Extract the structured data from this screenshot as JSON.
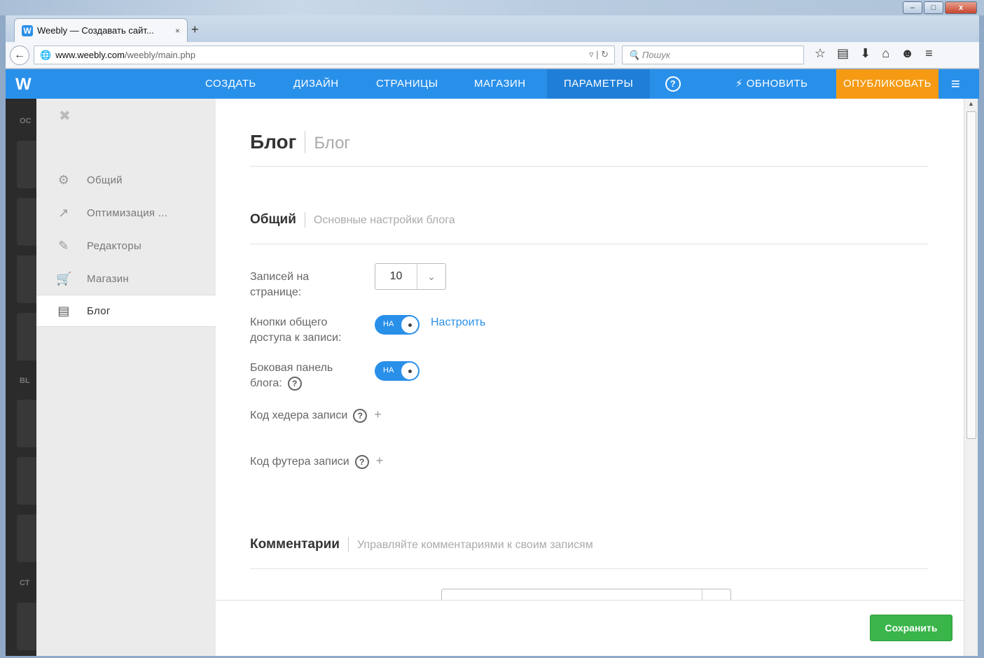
{
  "browser": {
    "tab_title": "Weebly — Создавать сайт...",
    "tab_close": "×",
    "new_tab": "+",
    "url_host": "www.weebly.com",
    "url_path": "/weebly/main.php",
    "search_placeholder": "Пошук",
    "window_controls": [
      "–",
      "□",
      "x"
    ]
  },
  "header": {
    "logo": "W",
    "menu": [
      {
        "label": "СОЗДАТЬ"
      },
      {
        "label": "ДИЗАЙН"
      },
      {
        "label": "СТРАНИЦЫ"
      },
      {
        "label": "МАГАЗИН"
      },
      {
        "label": "ПАРАМЕТРЫ",
        "active": true
      }
    ],
    "help": "?",
    "update_label": "ОБНОВИТЬ",
    "publish_label": "ОПУБЛИКОВАТЬ",
    "menu_icon": "≡",
    "accent_color": "#2990ea",
    "publish_color": "#f59a12"
  },
  "rail": {
    "labels": [
      "ОС",
      "BL",
      "СТ"
    ]
  },
  "sidebar": {
    "close": "✖",
    "items": [
      {
        "label": "Общий",
        "icon": "gear-icon"
      },
      {
        "label": "Оптимизация ...",
        "icon": "trend-icon"
      },
      {
        "label": "Редакторы",
        "icon": "pencil-icon"
      },
      {
        "label": "Магазин",
        "icon": "cart-icon"
      },
      {
        "label": "Блог",
        "icon": "comment-icon",
        "active": true
      }
    ]
  },
  "main": {
    "page_title": "Блог",
    "page_subtitle": "Блог",
    "general": {
      "title": "Общий",
      "subtitle": "Основные настройки блога",
      "posts_per_page_label": "Записей на странице:",
      "posts_per_page_value": "10",
      "share_buttons_label": "Кнопки общего доступа к записи:",
      "share_toggle": "НА",
      "configure_link": "Настроить",
      "sidebar_label": "Боковая панель блога:",
      "sidebar_toggle": "НА",
      "header_code_label": "Код хедера записи",
      "footer_code_label": "Код футера записи"
    },
    "comments": {
      "title": "Комментарии",
      "subtitle": "Управляйте комментариями к своим записям"
    }
  },
  "footer": {
    "save_label": "Сохранить",
    "save_color": "#3ab54a"
  }
}
